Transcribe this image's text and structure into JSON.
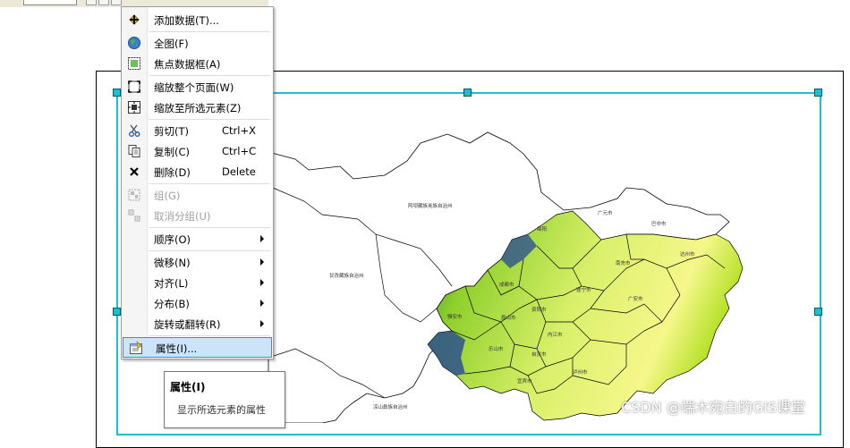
{
  "menu": {
    "items": [
      {
        "label": "添加数据(T)...",
        "shortcut": "",
        "icon": "add-data-icon",
        "disabled": false,
        "submenu": false
      },
      {
        "label": "全图(F)",
        "shortcut": "",
        "icon": "globe-icon",
        "disabled": false,
        "submenu": false
      },
      {
        "label": "焦点数据框(A)",
        "shortcut": "",
        "icon": "focus-frame-icon",
        "disabled": false,
        "submenu": false
      },
      {
        "label": "缩放整个页面(W)",
        "shortcut": "",
        "icon": "zoom-page-icon",
        "disabled": false,
        "submenu": false
      },
      {
        "label": "缩放至所选元素(Z)",
        "shortcut": "",
        "icon": "zoom-selected-icon",
        "disabled": false,
        "submenu": false
      },
      {
        "label": "剪切(T)",
        "shortcut": "Ctrl+X",
        "icon": "scissors-icon",
        "disabled": false,
        "submenu": false
      },
      {
        "label": "复制(C)",
        "shortcut": "Ctrl+C",
        "icon": "copy-icon",
        "disabled": false,
        "submenu": false
      },
      {
        "label": "删除(D)",
        "shortcut": "Delete",
        "icon": "delete-x-icon",
        "disabled": false,
        "submenu": false
      },
      {
        "label": "组(G)",
        "shortcut": "",
        "icon": "group-icon",
        "disabled": true,
        "submenu": false
      },
      {
        "label": "取消分组(U)",
        "shortcut": "",
        "icon": "ungroup-icon",
        "disabled": true,
        "submenu": false
      },
      {
        "label": "顺序(O)",
        "shortcut": "",
        "icon": "",
        "disabled": false,
        "submenu": true
      },
      {
        "label": "微移(N)",
        "shortcut": "",
        "icon": "",
        "disabled": false,
        "submenu": true
      },
      {
        "label": "对齐(L)",
        "shortcut": "",
        "icon": "",
        "disabled": false,
        "submenu": true
      },
      {
        "label": "分布(B)",
        "shortcut": "",
        "icon": "",
        "disabled": false,
        "submenu": true
      },
      {
        "label": "旋转或翻转(R)",
        "shortcut": "",
        "icon": "",
        "disabled": false,
        "submenu": true
      },
      {
        "label": "属性(I)...",
        "shortcut": "",
        "icon": "properties-icon",
        "disabled": false,
        "submenu": false,
        "highlighted": true
      }
    ]
  },
  "tooltip": {
    "title": "属性(I)",
    "description": "显示所选元素的属性"
  },
  "map": {
    "labels": {
      "aba": "阿坝藏族羌族自治州",
      "ganzi": "甘孜藏族自治州",
      "liangshan": "凉山彝族自治州",
      "guangyuan": "广元市",
      "bazhong": "巴中市",
      "mianyang": "绵阳",
      "nanchong": "南充市",
      "dazhou": "达州市",
      "chengdu": "成都市",
      "suining": "遂宁市",
      "guangan": "广安市",
      "ziyang": "资阳市",
      "yaan": "雅安市",
      "meishan": "眉山市",
      "neijiang": "内江市",
      "leshan": "乐山市",
      "zigong": "自贡市",
      "yibin": "宜宾市",
      "luzhou": "泸州市"
    },
    "colors": {
      "low": "#f6f78a",
      "mid": "#b6e22a",
      "high": "#3a9f3f",
      "peak": "#1d3f9a",
      "selection": "#19c0d2"
    }
  },
  "watermark": "CSDN @端木宛白的GIS课堂"
}
